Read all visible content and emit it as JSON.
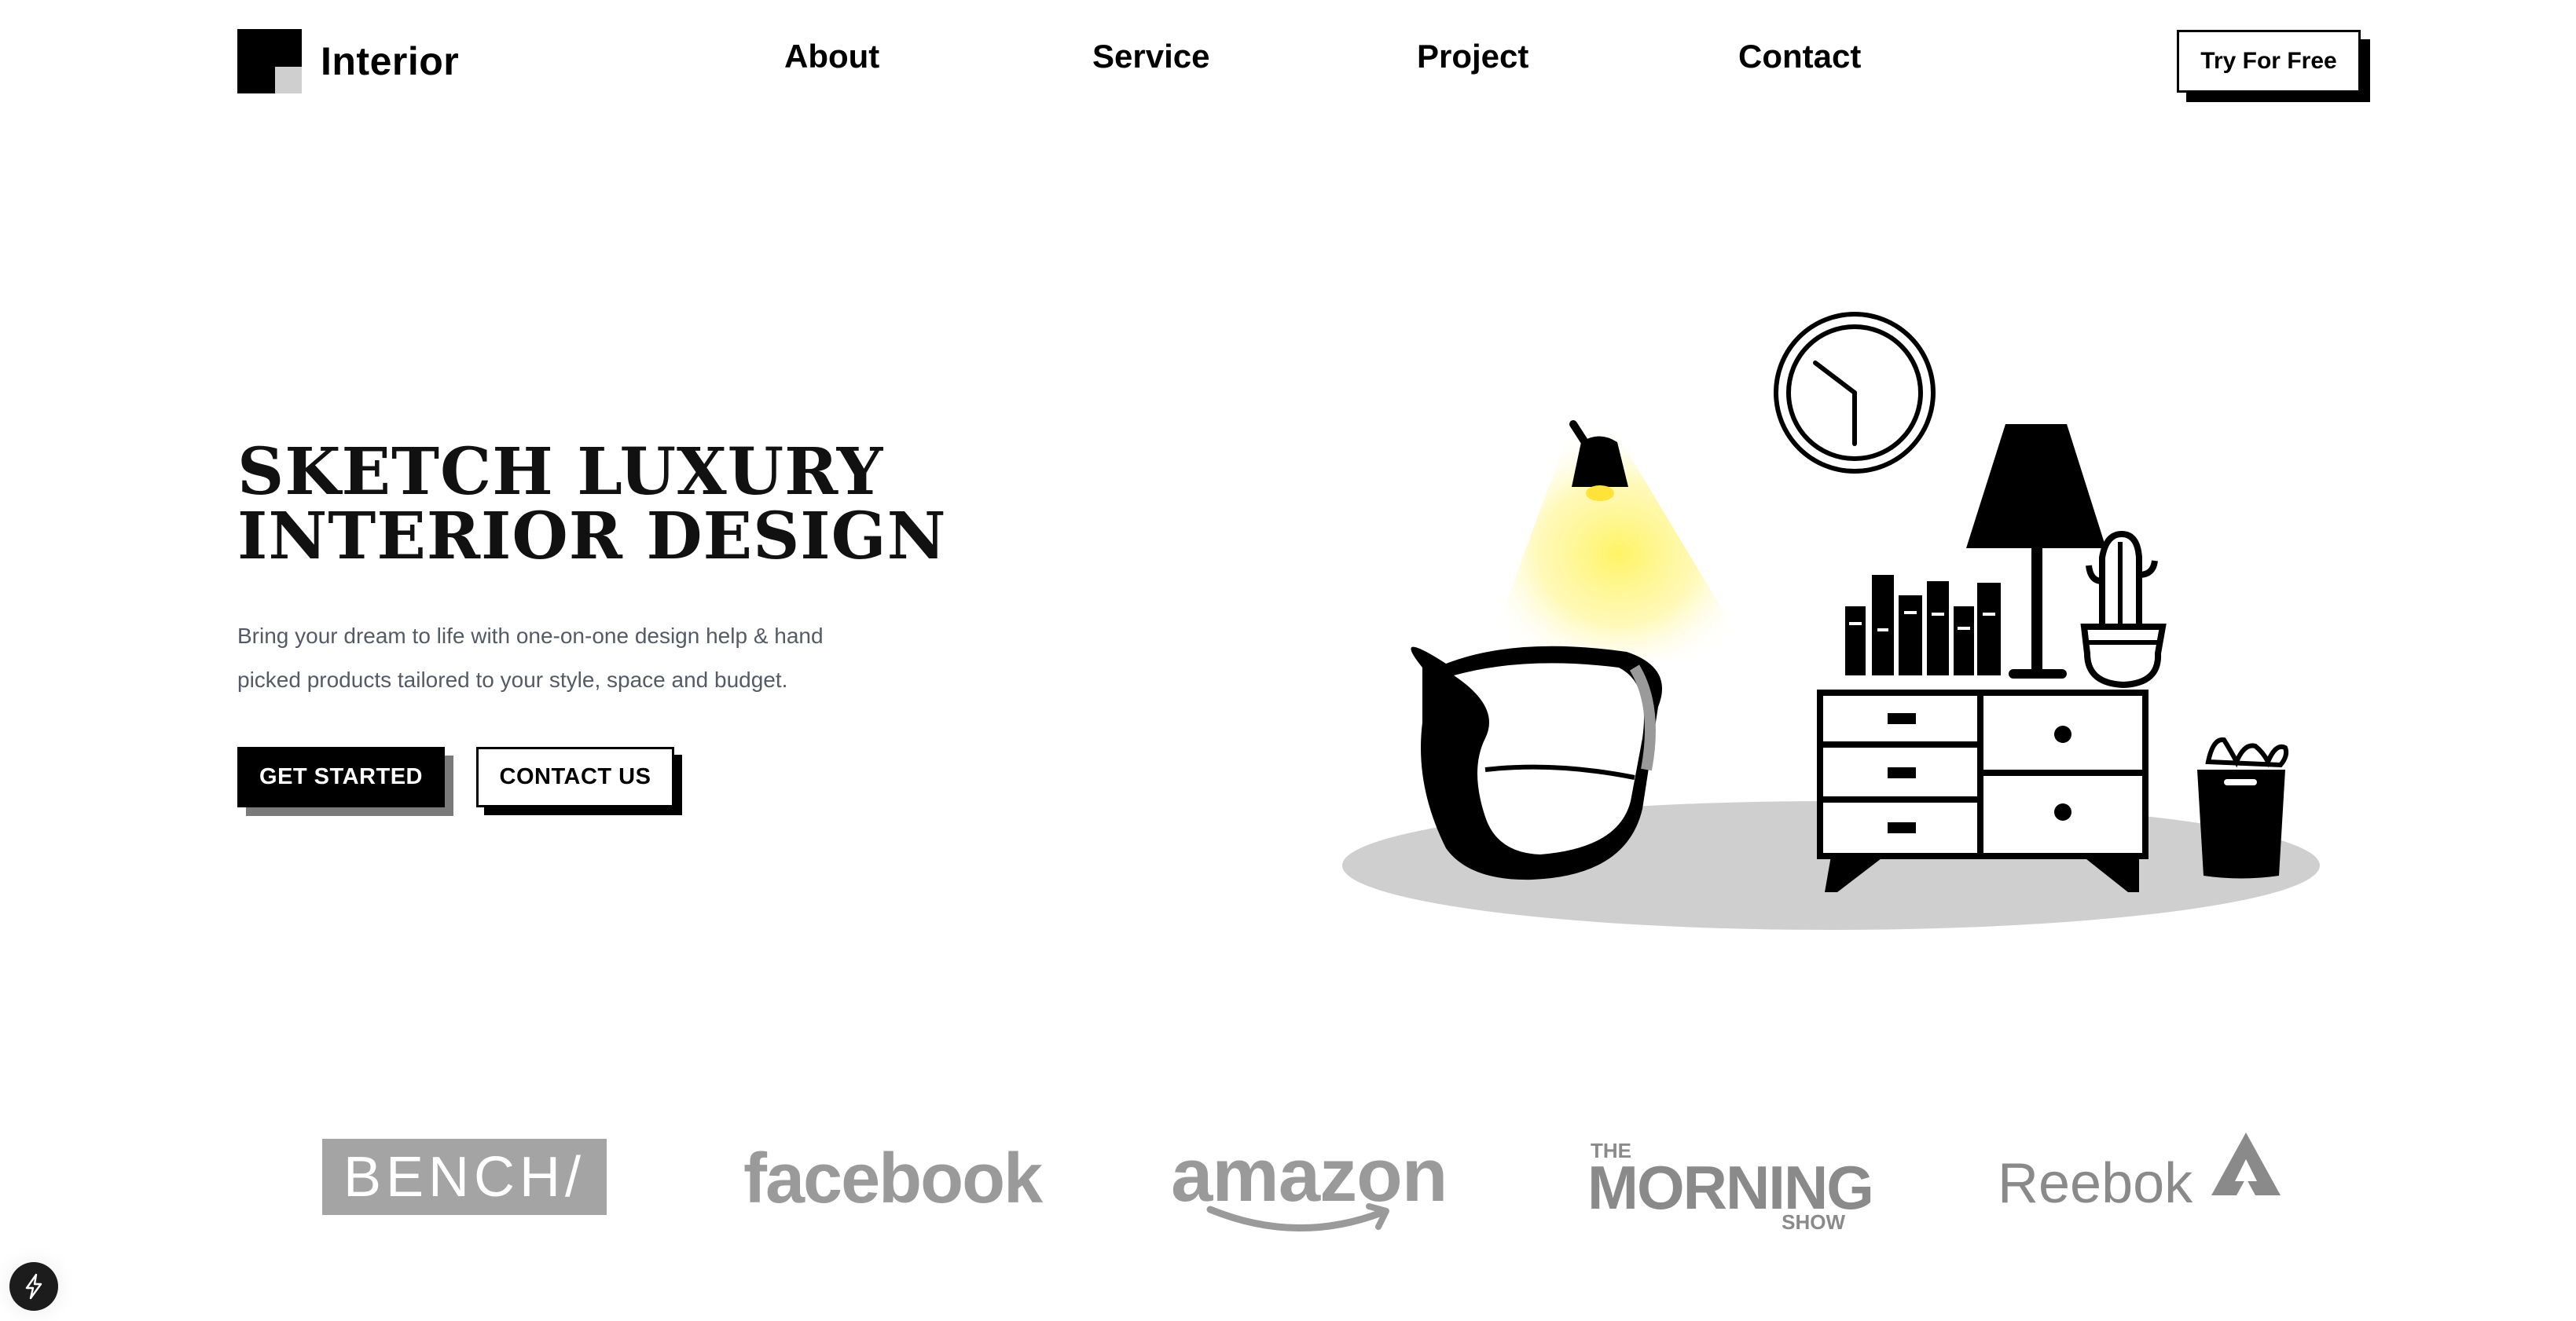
{
  "nav": {
    "brand": "Interior",
    "links": [
      "About",
      "Service",
      "Project",
      "Contact"
    ],
    "cta": "Try For Free"
  },
  "hero": {
    "title_line1": "SKETCH LUXURY",
    "title_line2": "INTERIOR DESIGN",
    "desc_line1": "Bring your dream to life with one-on-one design help & hand",
    "desc_line2": "picked products tailored to your style, space and budget.",
    "primary_button": "GET STARTED",
    "secondary_button": "CONTACT US"
  },
  "logos": {
    "bench": "BENCH/",
    "facebook": "facebook",
    "amazon": "amazon",
    "morning_the": "THE",
    "morning_main": "MORNING",
    "morning_show": "SHOW",
    "reebok": "Reebok"
  },
  "icons": {
    "corner_badge": "lightning-icon",
    "logo_mark": "logo-square-icon"
  },
  "colors": {
    "primary": "#000000",
    "muted_text": "#555b66",
    "logo_gray": "#9a9a9a",
    "lamp_light": "#fff35c",
    "rug": "#cfcfcf"
  }
}
